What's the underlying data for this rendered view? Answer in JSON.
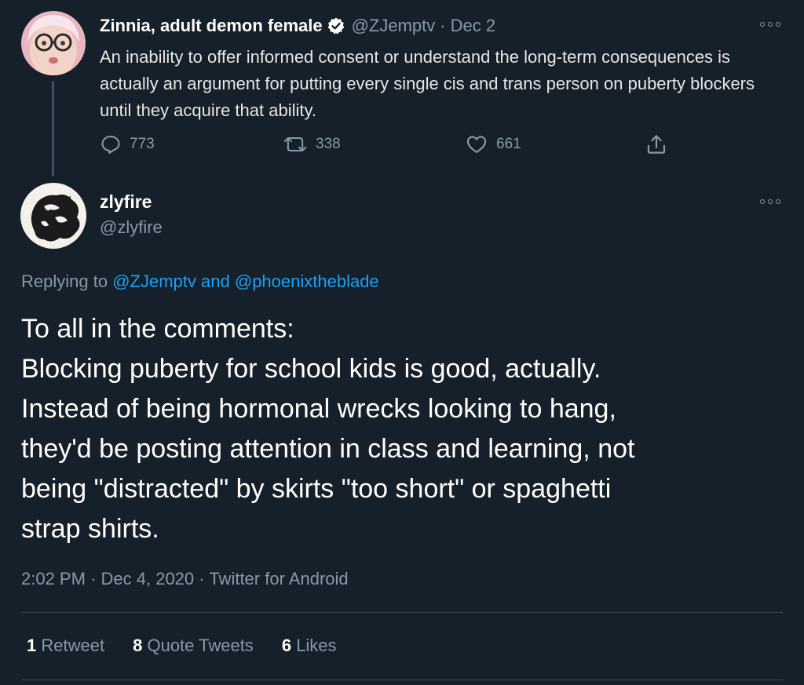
{
  "parent_tweet": {
    "display_name": "Zinnia, adult demon female",
    "handle": "@ZJemptv",
    "separator": "·",
    "date": "Dec 2",
    "text": "An inability to offer informed consent or understand the long-term consequences is actually an argument for putting every single cis and trans person on puberty blockers until they acquire that ability.",
    "replies": "773",
    "retweets": "338",
    "likes": "661",
    "icons": [
      "verified-icon",
      "reply-icon",
      "retweet-icon",
      "like-icon",
      "share-icon",
      "more-icon"
    ]
  },
  "main_tweet": {
    "display_name": "zlyfire",
    "handle": "@zlyfire",
    "replying_prefix": "Replying to",
    "replying_user1": "@ZJemptv",
    "replying_and": "and",
    "replying_user2": "@phoenixtheblade",
    "text_lines": [
      "To all in the comments:",
      "Blocking puberty for school kids is good, actually.",
      "Instead of being hormonal wrecks looking to hang,",
      "they'd be posting attention in class and learning, not",
      "being \"distracted\" by skirts \"too short\" or spaghetti",
      "strap shirts."
    ],
    "time": "2:02 PM",
    "separator": "·",
    "date": "Dec 4, 2020",
    "source": "Twitter for Android",
    "stats": {
      "retweets_count": "1",
      "retweets_label": "Retweet",
      "quotes_count": "8",
      "quotes_label": "Quote Tweets",
      "likes_count": "6",
      "likes_label": "Likes"
    }
  },
  "colors": {
    "background": "#15202b",
    "secondary_text": "#8899a6",
    "link": "#1da1f2",
    "divider": "#38444d"
  }
}
